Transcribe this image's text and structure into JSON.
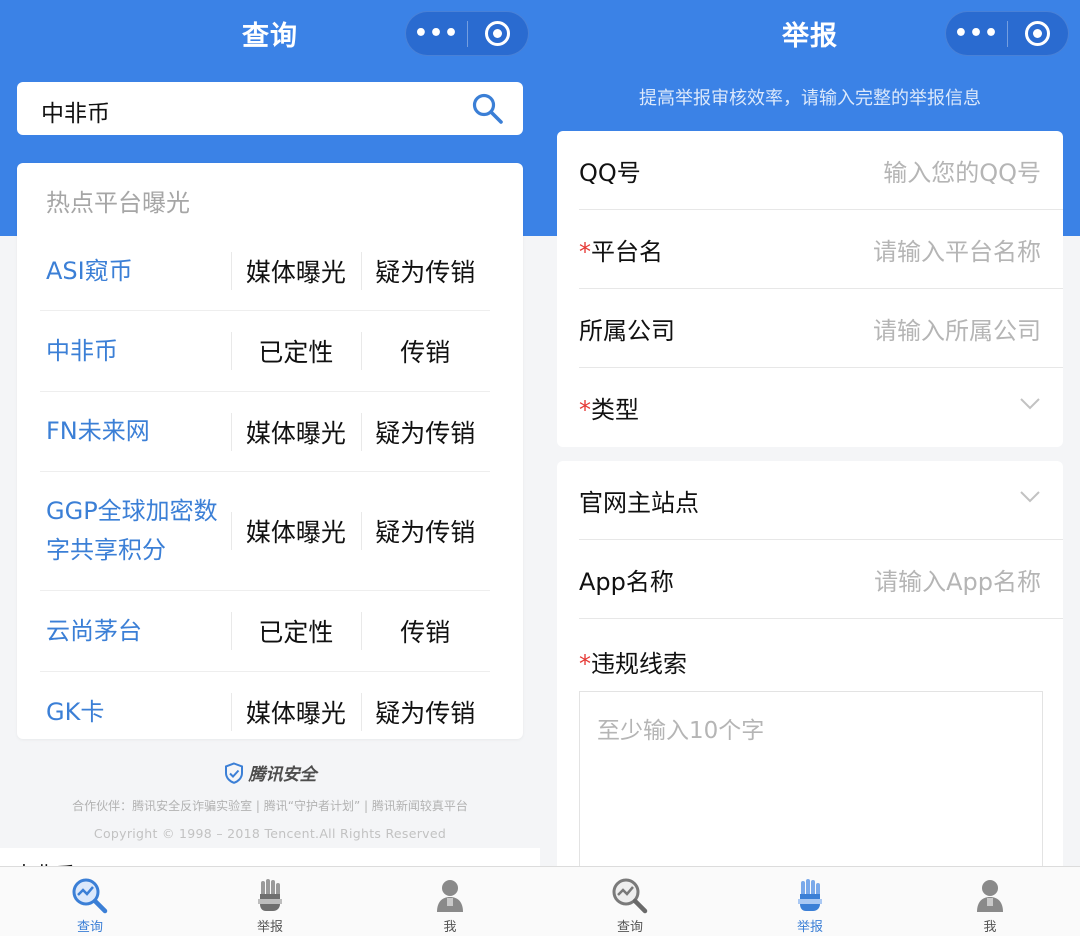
{
  "left": {
    "title": "查询",
    "capsule_more": "•••",
    "search_value": "中非币",
    "hot": {
      "title": "热点平台曝光",
      "rows": [
        {
          "name": "ASI窥币",
          "c1": "媒体曝光",
          "c2": "疑为传销"
        },
        {
          "name": "中非币",
          "c1": "已定性",
          "c2": "传销"
        },
        {
          "name": "FN未来网",
          "c1": "媒体曝光",
          "c2": "疑为传销"
        },
        {
          "name": "GGP全球加密数字共享积分",
          "c1": "媒体曝光",
          "c2": "疑为传销"
        },
        {
          "name": "云尚茅台",
          "c1": "已定性",
          "c2": "传销"
        },
        {
          "name": "GK卡",
          "c1": "媒体曝光",
          "c2": "疑为传销"
        }
      ]
    },
    "brand": "腾讯安全",
    "partners": "合作伙伴：腾讯安全反诈骗实验室 | 腾讯“守护者计划” | 腾讯新闻较真平台",
    "copyright": "Copyright © 1998 – 2018 Tencent.All Rights Reserved",
    "peek_text": "中非币",
    "tabs": [
      {
        "label": "查询",
        "icon": "search-chart-icon",
        "active": true
      },
      {
        "label": "举报",
        "icon": "hand-report-icon",
        "active": false
      },
      {
        "label": "我",
        "icon": "person-icon",
        "active": false
      }
    ]
  },
  "right": {
    "title": "举报",
    "capsule_more": "•••",
    "subtitle": "提高举报审核效率，请输入完整的举报信息",
    "card1": [
      {
        "label": "QQ号",
        "required": false,
        "placeholder": "输入您的QQ号"
      },
      {
        "label": "平台名",
        "required": true,
        "placeholder": "请输入平台名称"
      },
      {
        "label": "所属公司",
        "required": false,
        "placeholder": "请输入所属公司"
      },
      {
        "label": "类型",
        "required": true,
        "placeholder": ""
      }
    ],
    "card2": [
      {
        "label": "官网主站点",
        "required": false,
        "placeholder": ""
      },
      {
        "label": "App名称",
        "required": false,
        "placeholder": "请输入App名称"
      }
    ],
    "violation_label": "违规线索",
    "violation_placeholder": "至少输入10个字",
    "required_mark": "*",
    "tabs": [
      {
        "label": "查询",
        "icon": "search-chart-icon",
        "active": false
      },
      {
        "label": "举报",
        "icon": "hand-report-icon",
        "active": true
      },
      {
        "label": "我",
        "icon": "person-icon",
        "active": false
      }
    ]
  },
  "colors": {
    "brand_blue": "#3b82e6",
    "link_blue": "#3b7fd6",
    "required_red": "#e53935"
  }
}
